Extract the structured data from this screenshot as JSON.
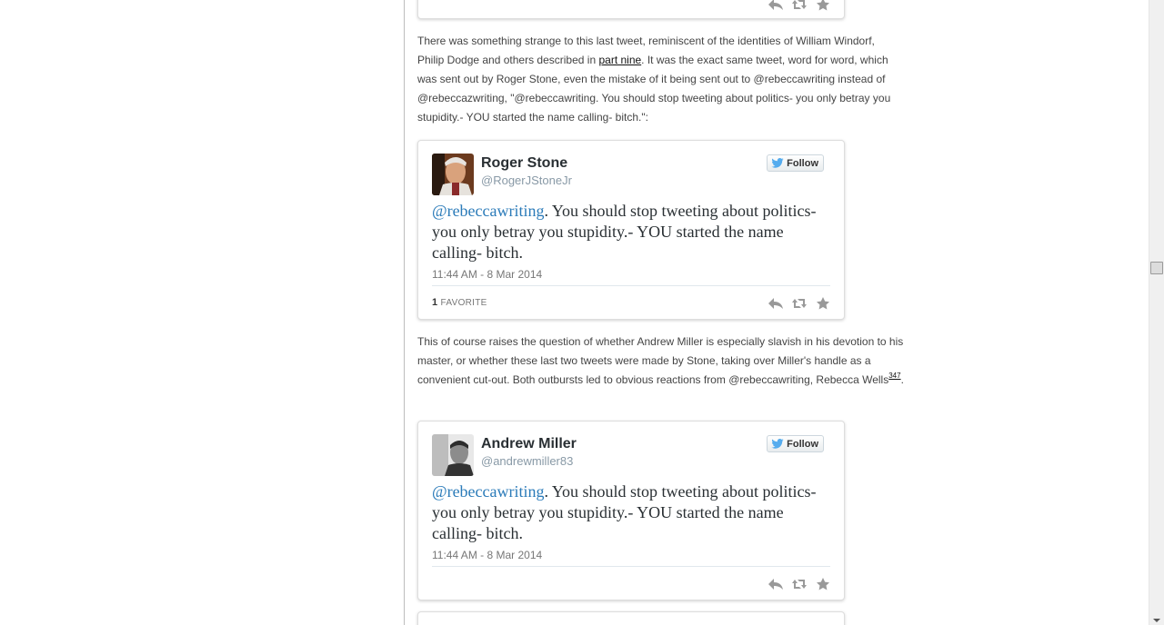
{
  "paragraph1": {
    "before": "There was something strange to this last tweet, reminiscent of the identities of William Windorf, Philip Dodge and others described in ",
    "link": "part nine",
    "after": ". It was the exact same tweet, word for word, which was sent out by Roger Stone, even the mistake of it being sent out to @rebeccawriting instead of @rebeccazwriting, \"@rebeccawriting. You should stop tweeting about politics- you only betray you stupidity.- YOU started the name calling- bitch.\":"
  },
  "paragraph2": {
    "text": "This of course raises the question of whether Andrew Miller is especially slavish in his devotion to his master, or whether these last two tweets were made by Stone, taking over Miller's handle as a convenient cut-out. Both outbursts led to obvious reactions from @rebeccawriting, Rebecca Wells",
    "footnote": "347",
    "end": "."
  },
  "tweet1": {
    "name": "Roger Stone",
    "handle": "@RogerJStoneJr",
    "follow_label": "Follow",
    "mention": "@rebeccawriting",
    "text": ". You should stop tweeting about politics- you only betray you stupidity.- YOU started the name calling- bitch.",
    "date": "11:44 AM - 8 Mar 2014",
    "favorites_count": "1",
    "favorites_label": "FAVORITE"
  },
  "tweet2": {
    "name": "Andrew Miller",
    "handle": "@andrewmiller83",
    "follow_label": "Follow",
    "mention": "@rebeccawriting",
    "text": ". You should stop tweeting about politics- you only betray you stupidity.- YOU started the name calling- bitch.",
    "date": "11:44 AM - 8 Mar 2014"
  },
  "colors": {
    "mention": "#2b7bb9",
    "twitter_bird": "#55acee",
    "action_icon": "#999999"
  },
  "icons": [
    "reply-icon",
    "retweet-icon",
    "favorite-icon",
    "twitter-bird-icon"
  ]
}
